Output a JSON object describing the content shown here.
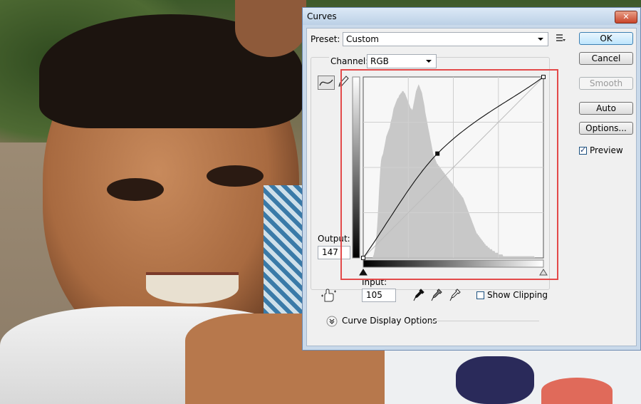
{
  "window": {
    "title": "Curves",
    "close_glyph": "✕"
  },
  "preset": {
    "label": "Preset:",
    "value": "Custom"
  },
  "channel": {
    "label": "Channel:",
    "value": "RGB"
  },
  "buttons": {
    "ok": "OK",
    "cancel": "Cancel",
    "smooth": "Smooth",
    "auto": "Auto",
    "options": "Options..."
  },
  "preview": {
    "label": "Preview",
    "checked": true
  },
  "output": {
    "label": "Output:",
    "value": "147"
  },
  "input": {
    "label": "Input:",
    "value": "105"
  },
  "show_clipping": {
    "label": "Show Clipping",
    "checked": false
  },
  "curve_display_options": {
    "label": "Curve Display Options"
  },
  "curve": {
    "control_points": [
      [
        0,
        0
      ],
      [
        105,
        147
      ],
      [
        255,
        255
      ]
    ],
    "selected_point": [
      105,
      147
    ]
  },
  "histogram": {
    "bins": [
      0,
      0,
      0,
      0,
      0,
      0,
      0,
      0,
      0,
      0,
      0,
      0,
      0,
      0,
      0,
      1,
      2,
      4,
      6,
      9,
      13,
      18,
      24,
      31,
      39,
      46,
      52,
      56,
      58,
      59,
      60,
      62,
      64,
      66,
      68,
      70,
      71,
      72,
      73,
      74,
      75,
      77,
      79,
      80,
      82,
      84,
      86,
      87,
      88,
      89,
      90,
      91,
      92,
      92,
      93,
      94,
      94,
      95,
      95,
      96,
      96,
      96,
      95,
      95,
      94,
      93,
      92,
      91,
      90,
      89,
      88,
      87,
      86,
      86,
      85,
      86,
      88,
      90,
      92,
      94,
      96,
      97,
      98,
      99,
      100,
      99,
      98,
      97,
      96,
      95,
      93,
      91,
      89,
      87,
      84,
      82,
      80,
      78,
      76,
      74,
      72,
      70,
      68,
      66,
      64,
      62,
      60,
      59,
      58,
      57,
      56,
      55,
      54,
      54,
      53,
      53,
      52,
      52,
      51,
      51,
      50,
      50,
      49,
      49,
      48,
      48,
      47,
      47,
      46,
      46,
      45,
      45,
      44,
      44,
      43,
      43,
      42,
      42,
      41,
      41,
      40,
      40,
      39,
      39,
      38,
      38,
      37,
      37,
      36,
      36,
      35,
      35,
      34,
      33,
      32,
      31,
      30,
      29,
      28,
      27,
      26,
      25,
      24,
      23,
      22,
      21,
      20,
      19,
      18,
      17,
      16,
      15,
      14,
      14,
      13,
      13,
      12,
      12,
      11,
      11,
      10,
      10,
      9,
      9,
      8,
      8,
      7,
      7,
      7,
      6,
      6,
      6,
      5,
      5,
      5,
      5,
      4,
      4,
      4,
      4,
      3,
      3,
      3,
      3,
      3,
      2,
      2,
      2,
      2,
      2,
      2,
      2,
      1,
      1,
      1,
      1,
      1,
      1,
      1,
      1,
      1,
      1,
      1,
      1,
      1,
      1,
      1,
      1,
      1,
      1,
      1,
      1,
      1,
      1,
      1,
      1,
      1,
      1,
      1,
      1,
      1,
      1,
      1,
      1,
      1,
      1,
      1,
      1,
      1,
      1,
      1,
      1,
      1,
      1,
      1,
      1,
      1,
      1,
      1,
      1,
      0,
      0,
      0,
      0,
      0,
      0,
      0,
      0,
      0,
      0,
      0,
      0,
      0,
      0
    ]
  },
  "icons": {
    "preset_menu": "preset-menu-icon",
    "curve_tool": "curve-tool-icon",
    "pencil_tool": "pencil-icon",
    "hand_tool": "on-image-adjust-icon",
    "black_eyedropper": "black-point-eyedropper-icon",
    "gray_eyedropper": "gray-point-eyedropper-icon",
    "white_eyedropper": "white-point-eyedropper-icon",
    "expand": "expand-chevron-icon"
  },
  "colors": {
    "highlight_box": "#e34a4a",
    "grid_bg": "#f7f7f7",
    "histogram": "#c8c8c8"
  }
}
